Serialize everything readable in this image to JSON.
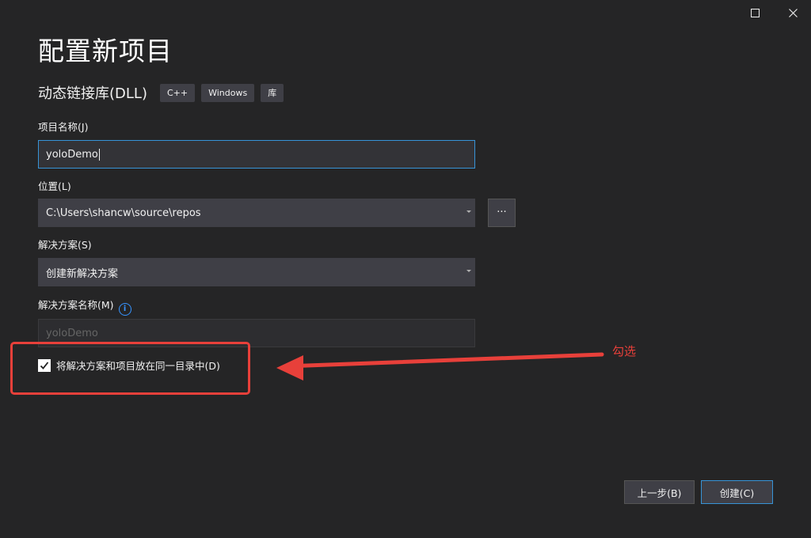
{
  "window": {
    "title": "配置新项目",
    "maximize_icon": "maximize-icon",
    "close_icon": "close-icon"
  },
  "template": {
    "name": "动态链接库(DLL)",
    "tags": [
      "C++",
      "Windows",
      "库"
    ]
  },
  "form": {
    "project_name": {
      "label": "项目名称(J)",
      "value": "yoloDemo"
    },
    "location": {
      "label": "位置(L)",
      "value": "C:\\Users\\shancw\\source\\repos",
      "browse_label": "..."
    },
    "solution": {
      "label": "解决方案(S)",
      "value": "创建新解决方案"
    },
    "solution_name": {
      "label": "解决方案名称(M)",
      "placeholder": "yoloDemo",
      "info_icon": "info-icon"
    },
    "same_dir": {
      "label": "将解决方案和项目放在同一目录中(D)",
      "checked": true
    }
  },
  "annotation": {
    "text": "勾选",
    "color": "#e8403a"
  },
  "buttons": {
    "back": "上一步(B)",
    "create": "创建(C)"
  },
  "colors": {
    "background": "#252526",
    "field": "#3f3f46",
    "focus_border": "#3794d7",
    "accent_red": "#e8403a"
  }
}
